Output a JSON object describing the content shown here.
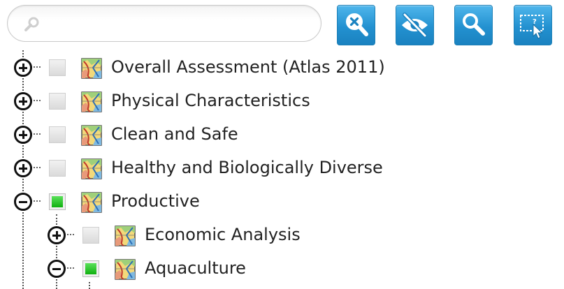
{
  "search": {
    "value": "",
    "placeholder": ""
  },
  "toolbar": {
    "buttons": [
      {
        "icon": "clear-search-icon"
      },
      {
        "icon": "hide-eye-icon"
      },
      {
        "icon": "search-magnifier-icon"
      },
      {
        "icon": "select-area-help-icon"
      }
    ]
  },
  "tree": {
    "items": [
      {
        "label": "Overall Assessment (Atlas 2011)",
        "level": 0,
        "expanded": false,
        "checked": false
      },
      {
        "label": "Physical Characteristics",
        "level": 0,
        "expanded": false,
        "checked": false
      },
      {
        "label": "Clean and Safe",
        "level": 0,
        "expanded": false,
        "checked": false
      },
      {
        "label": "Healthy and Biologically Diverse",
        "level": 0,
        "expanded": false,
        "checked": false
      },
      {
        "label": "Productive",
        "level": 0,
        "expanded": true,
        "checked": true
      },
      {
        "label": "Economic Analysis",
        "level": 1,
        "expanded": false,
        "checked": false
      },
      {
        "label": "Aquaculture",
        "level": 1,
        "expanded": true,
        "checked": true
      }
    ]
  },
  "colors": {
    "button_blue": "#2391d0",
    "checked_green": "#10b010",
    "text": "#222222"
  }
}
